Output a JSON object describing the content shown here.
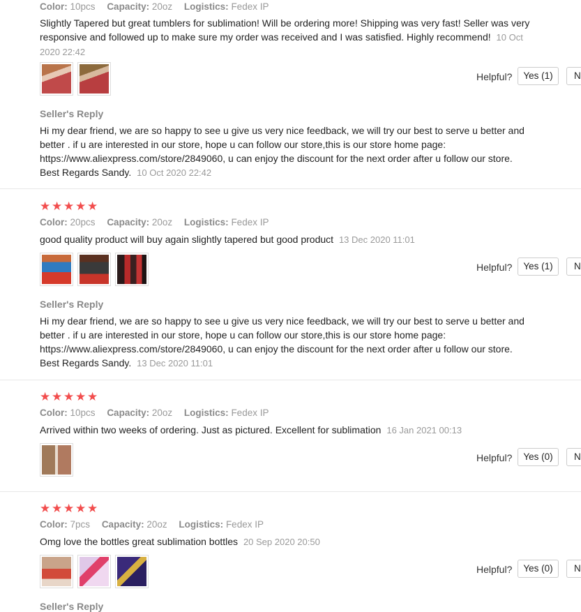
{
  "labels": {
    "color": "Color:",
    "capacity": "Capacity:",
    "logistics": "Logistics:",
    "helpful": "Helpful?",
    "no": "N",
    "sellers_reply": "Seller's Reply"
  },
  "colors": {
    "star": "#f24d4d",
    "muted": "#999999"
  },
  "reviews": [
    {
      "color": "10pcs",
      "capacity": "20oz",
      "logistics": "Fedex IP",
      "text": "Slightly Tapered but great tumblers for sublimation! Will be ordering more! Shipping was very fast! Seller was very responsive and followed up to make sure my order was received and I was satisfied. Highly recommend!",
      "date": "10 Oct 2020 22:42",
      "yes": "Yes (1)",
      "reply": "Hi my dear friend, we are so happy to see u give us very nice feedback, we will try our best to serve u better and better . if u are interested in our store, hope u can follow our store,this is our store home page: https://www.aliexpress.com/store/2849060, u can enjoy the discount for the next order after u follow our store. Best Regards Sandy.",
      "reply_date": "10 Oct 2020 22:42"
    },
    {
      "stars": "★★★★★",
      "color": "20pcs",
      "capacity": "20oz",
      "logistics": "Fedex IP",
      "text": "good quality product will buy again slightly tapered but good product",
      "date": "13 Dec 2020 11:01",
      "yes": "Yes (1)",
      "reply": "Hi my dear friend, we are so happy to see u give us very nice feedback, we will try our best to serve u better and better . if u are interested in our store, hope u can follow our store,this is our store home page: https://www.aliexpress.com/store/2849060, u can enjoy the discount for the next order after u follow our store. Best Regards Sandy.",
      "reply_date": "13 Dec 2020 11:01"
    },
    {
      "stars": "★★★★★",
      "color": "10pcs",
      "capacity": "20oz",
      "logistics": "Fedex IP",
      "text": "Arrived within two weeks of ordering. Just as pictured. Excellent for sublimation",
      "date": "16 Jan 2021 00:13",
      "yes": "Yes (0)"
    },
    {
      "stars": "★★★★★",
      "color": "7pcs",
      "capacity": "20oz",
      "logistics": "Fedex IP",
      "text": "Omg love the bottles great sublimation bottles",
      "date": "20 Sep 2020 20:50",
      "yes": "Yes (0)"
    }
  ]
}
